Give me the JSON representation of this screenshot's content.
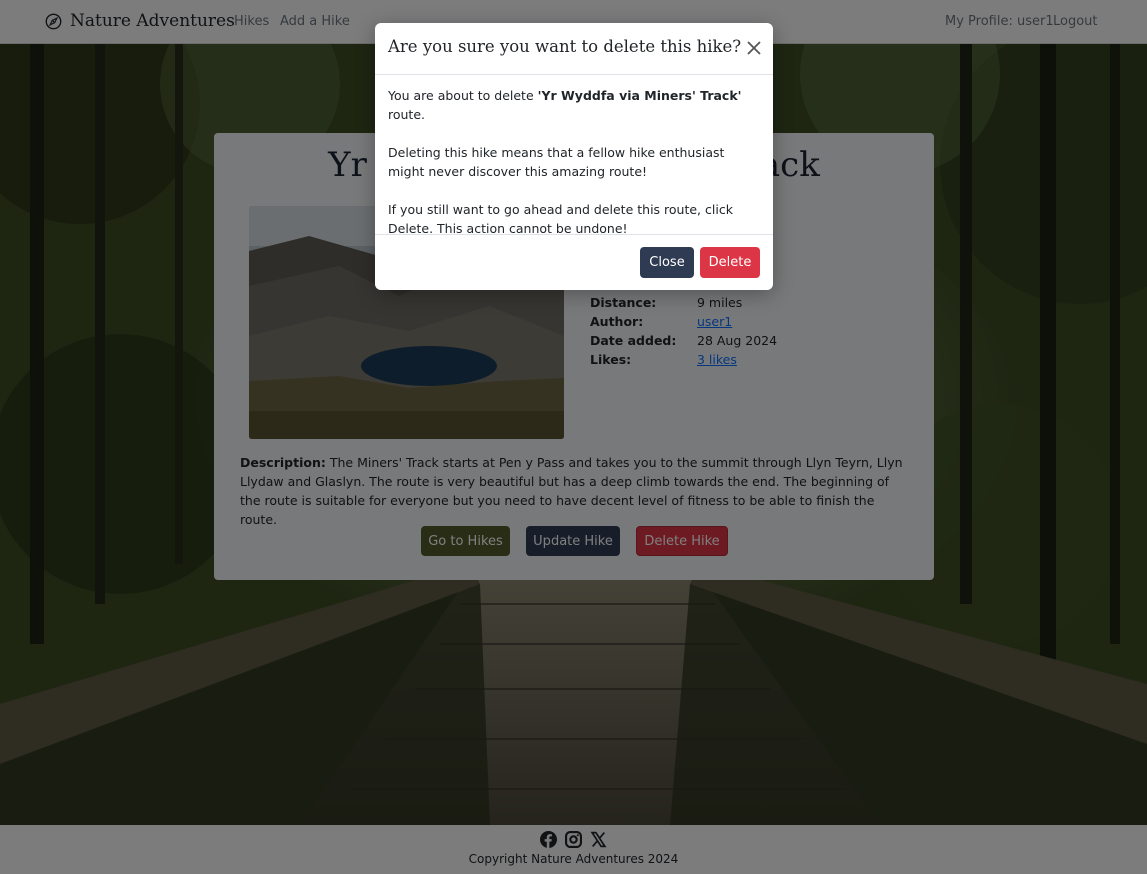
{
  "navbar": {
    "brand": "Nature Adventures",
    "links": [
      "Hikes",
      "Add a Hike"
    ],
    "profile": "My Profile: user1",
    "logout": "Logout"
  },
  "hike": {
    "title": "Yr Wyddfa via Miners' Track",
    "details": [
      {
        "label": "Distance:",
        "value": "9 miles"
      },
      {
        "label": "Author:",
        "value": "user1"
      },
      {
        "label": "Date added:",
        "value": "28 Aug 2024"
      },
      {
        "label": "Likes:",
        "value": "3 likes"
      }
    ],
    "description_label": "Description:",
    "description": "The Miners' Track starts at Pen y Pass and takes you to the summit through Llyn Teyrn, Llyn Llydaw and Glaslyn. The route is very beautiful but has a deep climb towards the end. The beginning of the route is suitable for everyone but you need to have decent level of fitness to be able to finish the route.",
    "buttons": {
      "go_to_hikes": "Go to Hikes",
      "update": "Update Hike",
      "delete": "Delete Hike"
    }
  },
  "modal": {
    "title": "Are you sure you want to delete this hike?",
    "body_prefix": "You are about to delete ",
    "body_route": "'Yr Wyddfa via Miners' Track'",
    "body_suffix": " route.",
    "paragraph2": "Deleting this hike means that a fellow hike enthusiast might never discover this amazing route!",
    "paragraph3": "If you still want to go ahead and delete this route, click Delete. This action cannot be undone!",
    "close_label": "Close",
    "delete_label": "Delete"
  },
  "footer": {
    "icons": [
      "facebook-icon",
      "instagram-icon",
      "x-icon"
    ],
    "copyright": "Copyright Nature Adventures 2024"
  },
  "colors": {
    "primary_dark": "#2f3b53",
    "danger": "#dc3545",
    "olive": "#535b2b"
  }
}
